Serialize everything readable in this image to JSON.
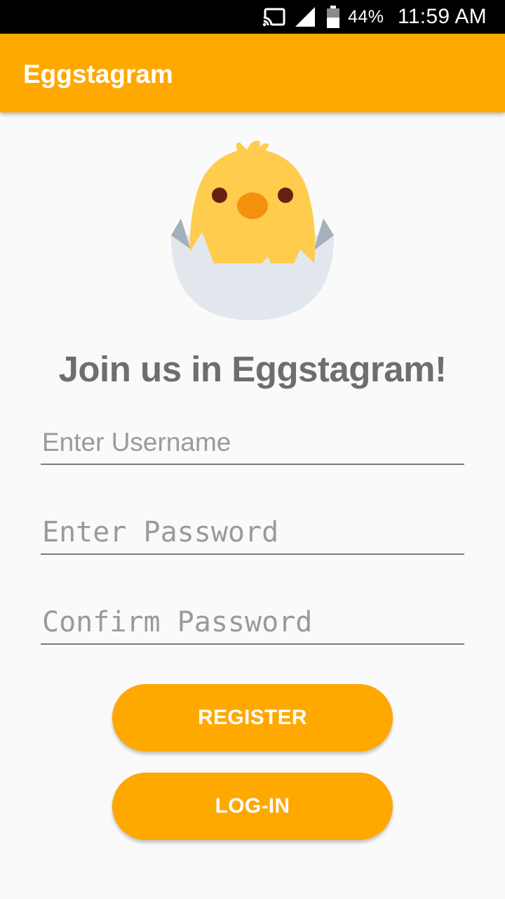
{
  "status_bar": {
    "icons": [
      "cast-icon",
      "signal-icon",
      "battery-icon"
    ],
    "battery_percent": "44%",
    "time": "11:59 AM"
  },
  "app_bar": {
    "title": "Eggstagram",
    "color": "#ffa800"
  },
  "illustration": {
    "icon": "hatching-chick-icon"
  },
  "main": {
    "heading": "Join us in Eggstagram!"
  },
  "form": {
    "username_placeholder": "Enter Username",
    "username_value": "",
    "password_placeholder": "Enter Password",
    "password_value": "",
    "confirm_password_placeholder": "Confirm Password",
    "confirm_password_value": ""
  },
  "buttons": {
    "register_label": "REGISTER",
    "login_label": "LOG-IN"
  },
  "colors": {
    "accent": "#ffa800",
    "heading_text": "#6e6e6e",
    "background": "#fafafa"
  }
}
